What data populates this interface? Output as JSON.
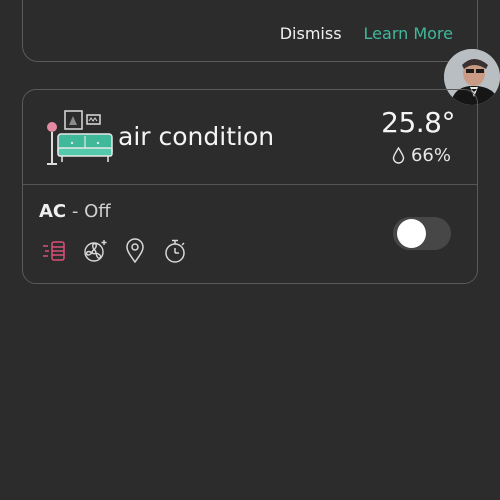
{
  "notice": {
    "dismiss_label": "Dismiss",
    "learn_more_label": "Learn More"
  },
  "device": {
    "room_name": "air condition",
    "temperature": "25.8°",
    "humidity": "66%",
    "device_name": "AC",
    "separator": " - ",
    "state": "Off",
    "power_on": false,
    "mode_icons": [
      "heat-mode-icon",
      "fan-mode-icon",
      "location-icon",
      "timer-icon"
    ]
  },
  "colors": {
    "background": "#2c2c2c",
    "accent": "#3fb99a",
    "heat_icon": "#d9507a"
  }
}
